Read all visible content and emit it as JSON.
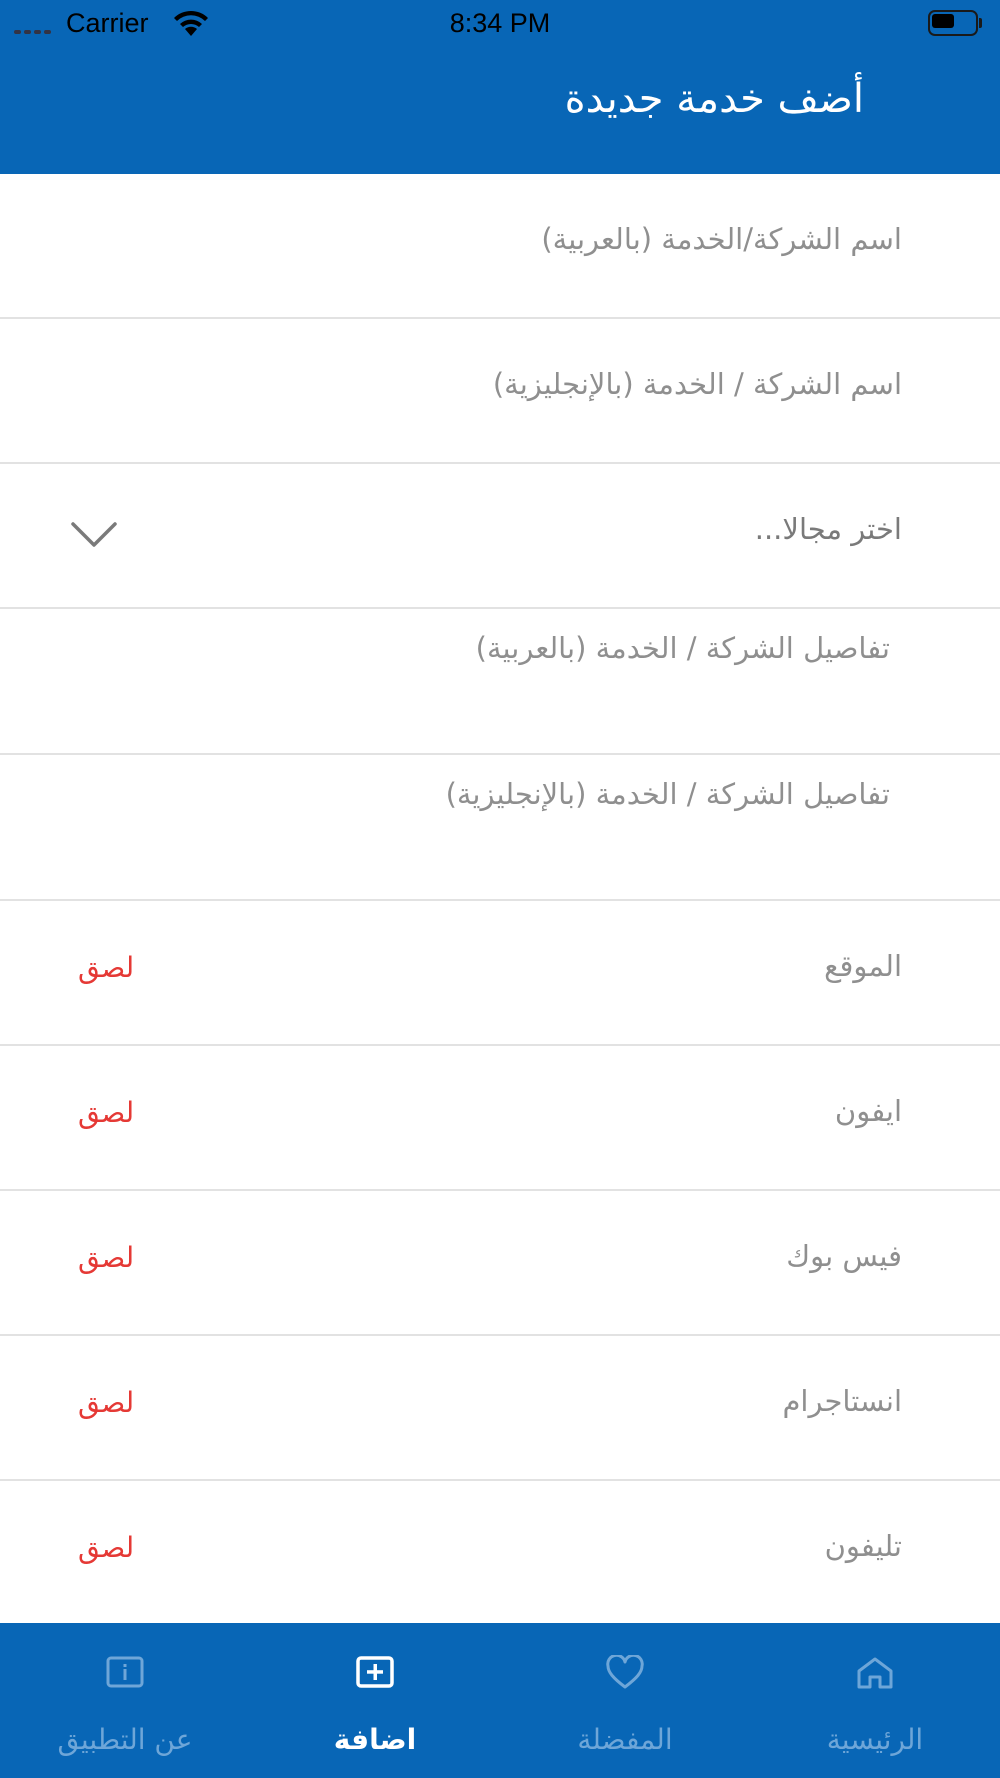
{
  "status_bar": {
    "carrier": "Carrier",
    "time": "8:34 PM"
  },
  "header": {
    "title": "أضف خدمة جديدة"
  },
  "form": {
    "name_ar_placeholder": "اسم الشركة/الخدمة (بالعربية)",
    "name_en_placeholder": "اسم الشركة / الخدمة (بالإنجليزية)",
    "category_placeholder": "اختر مجالا...",
    "details_ar_placeholder": "تفاصيل الشركة / الخدمة (بالعربية)",
    "details_en_placeholder": "تفاصيل الشركة / الخدمة (بالإنجليزية)",
    "link_fields": [
      {
        "label": "الموقع",
        "paste": "لصق"
      },
      {
        "label": "ايفون",
        "paste": "لصق"
      },
      {
        "label": "فيس بوك",
        "paste": "لصق"
      },
      {
        "label": "انستاجرام",
        "paste": "لصق"
      },
      {
        "label": "تليفون",
        "paste": "لصق"
      }
    ]
  },
  "tabbar": {
    "items": [
      {
        "label": "عن التطبيق",
        "icon": "info-icon",
        "active": false
      },
      {
        "label": "اضافة",
        "icon": "add-square-icon",
        "active": true
      },
      {
        "label": "المفضلة",
        "icon": "heart-icon",
        "active": false
      },
      {
        "label": "الرئيسية",
        "icon": "home-icon",
        "active": false
      }
    ]
  },
  "colors": {
    "primary": "#0866B6",
    "paste": "#E53935",
    "placeholder": "#8F8F8F",
    "tab_inactive": "#6EA6D8"
  }
}
